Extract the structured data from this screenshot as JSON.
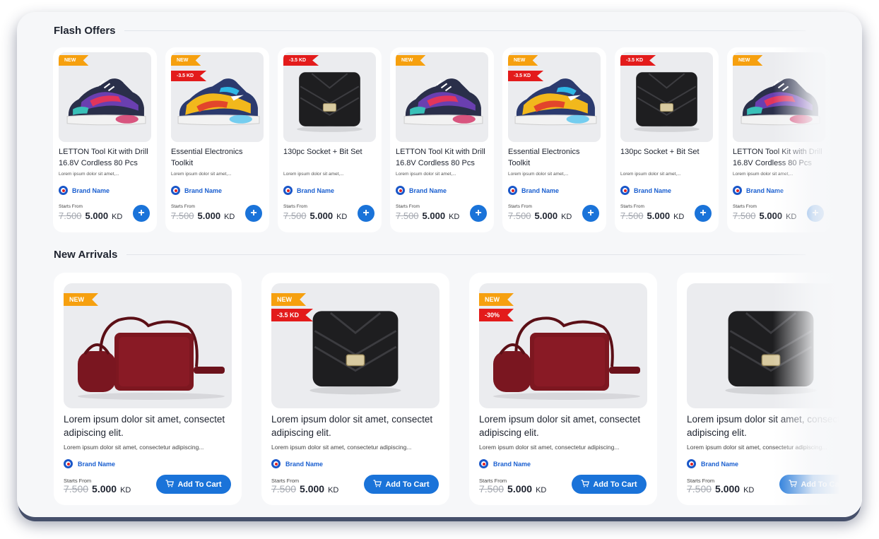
{
  "flash_offers": {
    "title": "Flash Offers",
    "items": [
      {
        "name": "LETTON Tool Kit with Drill 16.8V Cordless 80 Pcs",
        "desc": "Lorem ipsum dolor sit amet,...",
        "brand": "Brand Name",
        "starts_from": "Starts From",
        "old_price": "7.500",
        "price": "5.000",
        "currency": "KD",
        "add": "+",
        "image": "sneaker-dark",
        "badges": [
          "NEW"
        ]
      },
      {
        "name": "Essential Electronics Toolkit",
        "desc": "Lorem ipsum dolor sit amet,...",
        "brand": "Brand Name",
        "starts_from": "Starts From",
        "old_price": "7.500",
        "price": "5.000",
        "currency": "KD",
        "add": "+",
        "image": "sneaker-yellow",
        "badges": [
          "NEW",
          "-3.5 KD"
        ]
      },
      {
        "name": "130pc Socket + Bit Set",
        "desc": "Lorem ipsum dolor sit amet,...",
        "brand": "Brand Name",
        "starts_from": "Starts From",
        "old_price": "7.500",
        "price": "5.000",
        "currency": "KD",
        "add": "+",
        "image": "black-bag",
        "badges": [
          "-3.5 KD"
        ]
      },
      {
        "name": "LETTON Tool Kit with Drill 16.8V Cordless 80 Pcs",
        "desc": "Lorem ipsum dolor sit amet,...",
        "brand": "Brand Name",
        "starts_from": "Starts From",
        "old_price": "7.500",
        "price": "5.000",
        "currency": "KD",
        "add": "+",
        "image": "sneaker-dark",
        "badges": [
          "NEW"
        ]
      },
      {
        "name": "Essential Electronics Toolkit",
        "desc": "Lorem ipsum dolor sit amet,...",
        "brand": "Brand Name",
        "starts_from": "Starts From",
        "old_price": "7.500",
        "price": "5.000",
        "currency": "KD",
        "add": "+",
        "image": "sneaker-yellow",
        "badges": [
          "NEW",
          "-3.5 KD"
        ]
      },
      {
        "name": "130pc Socket + Bit Set",
        "desc": "Lorem ipsum dolor sit amet,...",
        "brand": "Brand Name",
        "starts_from": "Starts From",
        "old_price": "7.500",
        "price": "5.000",
        "currency": "KD",
        "add": "+",
        "image": "black-bag",
        "badges": [
          "-3.5 KD"
        ]
      },
      {
        "name": "LETTON Tool Kit with Drill 16.8V Cordless 80 Pcs",
        "desc": "Lorem ipsum dolor sit amet,...",
        "brand": "Brand Name",
        "starts_from": "Starts From",
        "old_price": "7.500",
        "price": "5.000",
        "currency": "KD",
        "add": "+",
        "image": "sneaker-dark",
        "badges": [
          "NEW"
        ]
      }
    ]
  },
  "new_arrivals": {
    "title": "New Arrivals",
    "items": [
      {
        "name": "Lorem ipsum dolor sit amet, consectet adipiscing elit.",
        "desc": "Lorem ipsum dolor sit amet, consectetur adipiscing...",
        "brand": "Brand Name",
        "starts_from": "Starts From",
        "old_price": "7.500",
        "price": "5.000",
        "currency": "KD",
        "cart": "Add To Cart",
        "image": "red-bag",
        "badges": [
          "NEW"
        ]
      },
      {
        "name": "Lorem ipsum dolor sit amet, consectet adipiscing elit.",
        "desc": "Lorem ipsum dolor sit amet, consectetur adipiscing...",
        "brand": "Brand Name",
        "starts_from": "Starts From",
        "old_price": "7.500",
        "price": "5.000",
        "currency": "KD",
        "cart": "Add To Cart",
        "image": "black-bag",
        "badges": [
          "NEW",
          "-3.5 KD"
        ]
      },
      {
        "name": "Lorem ipsum dolor sit amet, consectet adipiscing elit.",
        "desc": "Lorem ipsum dolor sit amet, consectetur adipiscing...",
        "brand": "Brand Name",
        "starts_from": "Starts From",
        "old_price": "7.500",
        "price": "5.000",
        "currency": "KD",
        "cart": "Add To Cart",
        "image": "red-bag",
        "badges": [
          "NEW",
          "-30%"
        ]
      },
      {
        "name": "Lorem ipsum dolor sit amet, consectet adipiscing elit.",
        "desc": "Lorem ipsum dolor sit amet, consectetur adipiscing...",
        "brand": "Brand Name",
        "starts_from": "Starts From",
        "old_price": "7.500",
        "price": "5.000",
        "currency": "KD",
        "cart": "Add To Cart",
        "image": "black-bag",
        "badges": []
      }
    ]
  },
  "colors": {
    "primary": "#1a73d9",
    "badge_new": "#f6a00f",
    "badge_discount": "#e31b1b",
    "brand_text": "#1a5fd0"
  },
  "icons": {
    "add": "plus-icon",
    "cart": "cart-icon",
    "brand": "brand-logo-icon"
  }
}
